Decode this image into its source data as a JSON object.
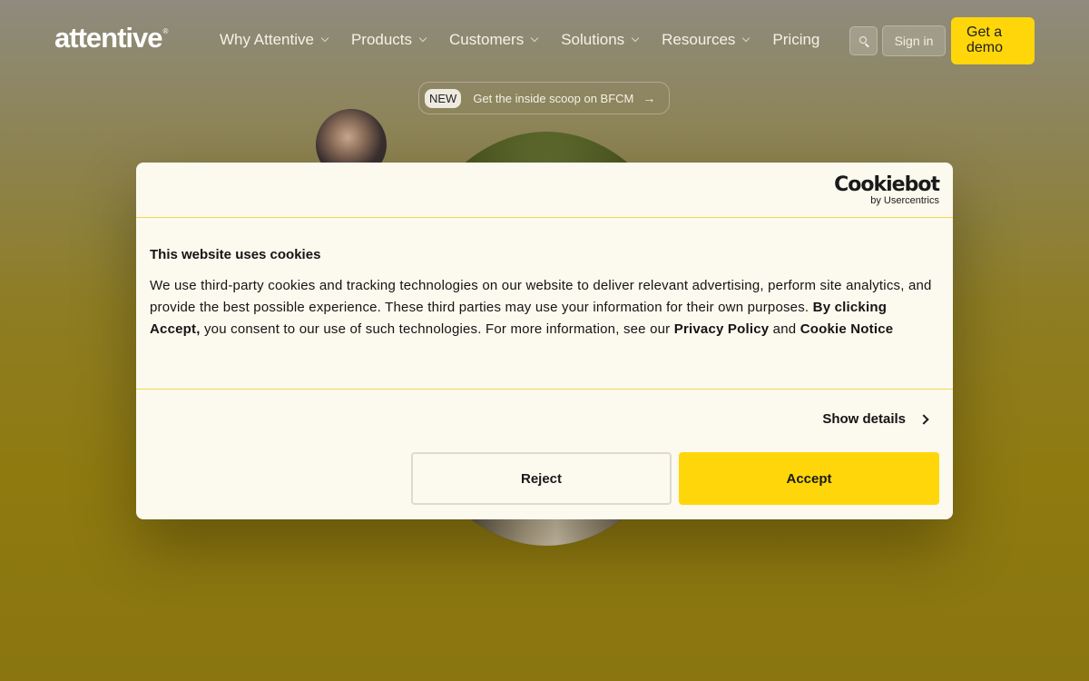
{
  "header": {
    "logo": "attentive",
    "logo_mark": "®",
    "menu": [
      {
        "label": "Why Attentive",
        "has_dropdown": true
      },
      {
        "label": "Products",
        "has_dropdown": true
      },
      {
        "label": "Customers",
        "has_dropdown": true
      },
      {
        "label": "Solutions",
        "has_dropdown": true
      },
      {
        "label": "Resources",
        "has_dropdown": true
      },
      {
        "label": "Pricing",
        "has_dropdown": false
      }
    ],
    "search_icon": "search-icon",
    "signin_label": "Sign in",
    "demo_label": "Get a demo"
  },
  "announcement": {
    "badge": "NEW",
    "text": "Get the inside scoop on BFCM",
    "arrow": "→"
  },
  "cookie_dialog": {
    "provider_brand": "Cookiebot",
    "provider_sub": "by Usercentrics",
    "title": "This website uses cookies",
    "text_1": "We use third-party cookies and tracking technologies on our website to deliver relevant advertising, perform site analytics, and provide the best possible experience. These third parties may use your information for their own purposes.",
    "text_bold_1": "By clicking Accept,",
    "text_2": "you consent to our use of such technologies. For more information, see our",
    "link_privacy": "Privacy Policy",
    "text_and": "and",
    "link_cookie": "Cookie Notice",
    "show_details": "Show details",
    "reject_label": "Reject",
    "accept_label": "Accept"
  },
  "colors": {
    "accent_yellow": "#ffd60a",
    "dialog_bg": "#fcf9ee",
    "divider": "#f0d948"
  }
}
